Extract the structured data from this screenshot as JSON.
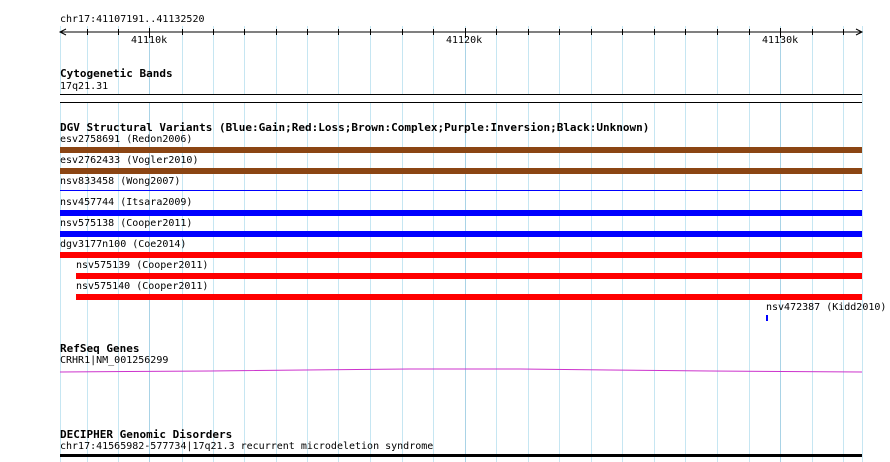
{
  "ruler": {
    "coords": "chr17:41107191..41132520",
    "ticks": [
      "41110k",
      "41120k",
      "41130k"
    ]
  },
  "tracks": {
    "cyto": {
      "title": "Cytogenetic Bands",
      "band": "17q21.31"
    },
    "dgv": {
      "title": "DGV Structural Variants (Blue:Gain;Red:Loss;Brown:Complex;Purple:Inversion;Black:Unknown)",
      "items": [
        {
          "label": "esv2758691 (Redon2006)",
          "color": "#8b4513"
        },
        {
          "label": "esv2762433 (Vogler2010)",
          "color": "#8b4513"
        },
        {
          "label": "nsv833458 (Wong2007)",
          "color": "#0000ff"
        },
        {
          "label": "nsv457744 (Itsara2009)",
          "color": "#0000ff"
        },
        {
          "label": "nsv575138 (Cooper2011)",
          "color": "#0000ff"
        },
        {
          "label": "dgv3177n100 (Coe2014)",
          "color": "#ff0000"
        },
        {
          "label": "nsv575139 (Cooper2011)",
          "color": "#ff0000"
        },
        {
          "label": "nsv575140 (Cooper2011)",
          "color": "#ff0000"
        },
        {
          "label": "nsv472387 (Kidd2010)",
          "color": "#0000ff"
        }
      ]
    },
    "refseq": {
      "title": "RefSeq Genes",
      "gene": "CRHR1|NM_001256299",
      "color": "#cc33cc"
    },
    "decipher": {
      "title": "DECIPHER Genomic Disorders",
      "item": "chr17:41565982-577734|17q21.3 recurrent microdeletion syndrome"
    }
  }
}
